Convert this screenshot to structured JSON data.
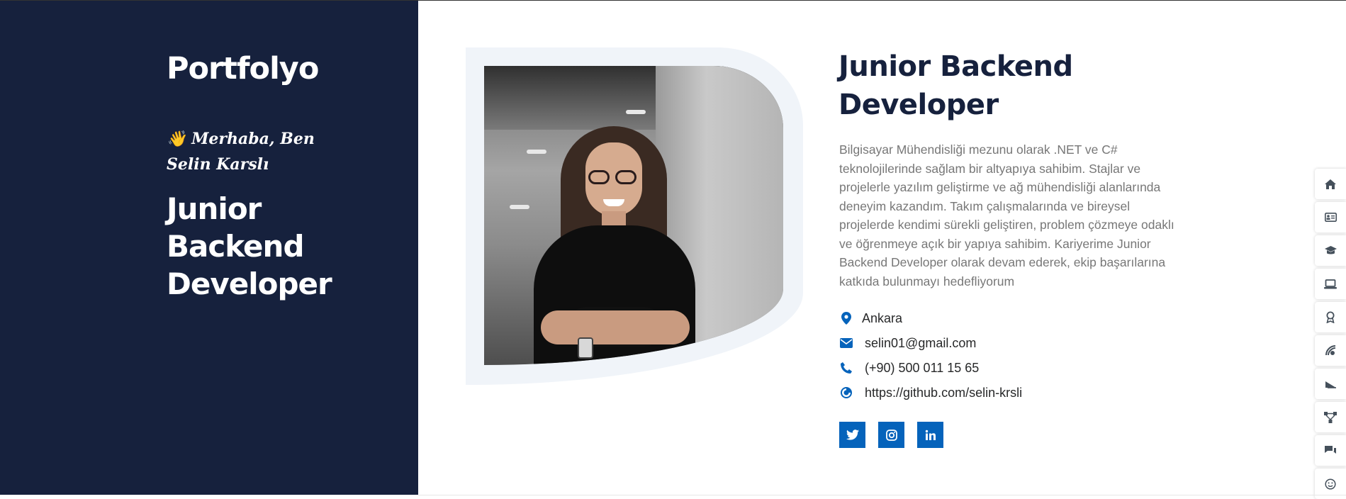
{
  "sidebar": {
    "brand": "Portfolyo",
    "greeting_emoji": "👋",
    "greeting": "Merhaba, Ben Selin Karslı",
    "title": "Junior Backend Developer"
  },
  "main": {
    "title": "Junior Backend Developer",
    "bio": "Bilgisayar Mühendisliği mezunu olarak .NET ve C# teknolojilerinde sağlam bir altyapıya sahibim. Stajlar ve projelerle yazılım geliştirme ve ağ mühendisliği alanlarında deneyim kazandım. Takım çalışmalarında ve bireysel projelerde kendimi sürekli geliştiren, problem çözmeye odaklı ve öğrenmeye açık bir yapıya sahibim. Kariyerime Junior Backend Developer olarak devam ederek, ekip başarılarına katkıda bulunmayı hedefliyorum",
    "info": {
      "location": "Ankara",
      "email": "selin01@gmail.com",
      "phone": "(+90) 500 011 15 65",
      "github": "https://github.com/selin-krsli"
    },
    "socials": [
      "twitter-icon",
      "instagram-icon",
      "linkedin-icon"
    ]
  },
  "nav_icons": [
    "home-icon",
    "id-card-icon",
    "graduation-cap-icon",
    "laptop-icon",
    "award-icon",
    "stack-icon",
    "plane-icon",
    "network-icon",
    "chat-icon",
    "smile-icon"
  ],
  "colors": {
    "sidebar": "#16213d",
    "accent": "#0563bb",
    "text_muted": "#777777"
  }
}
